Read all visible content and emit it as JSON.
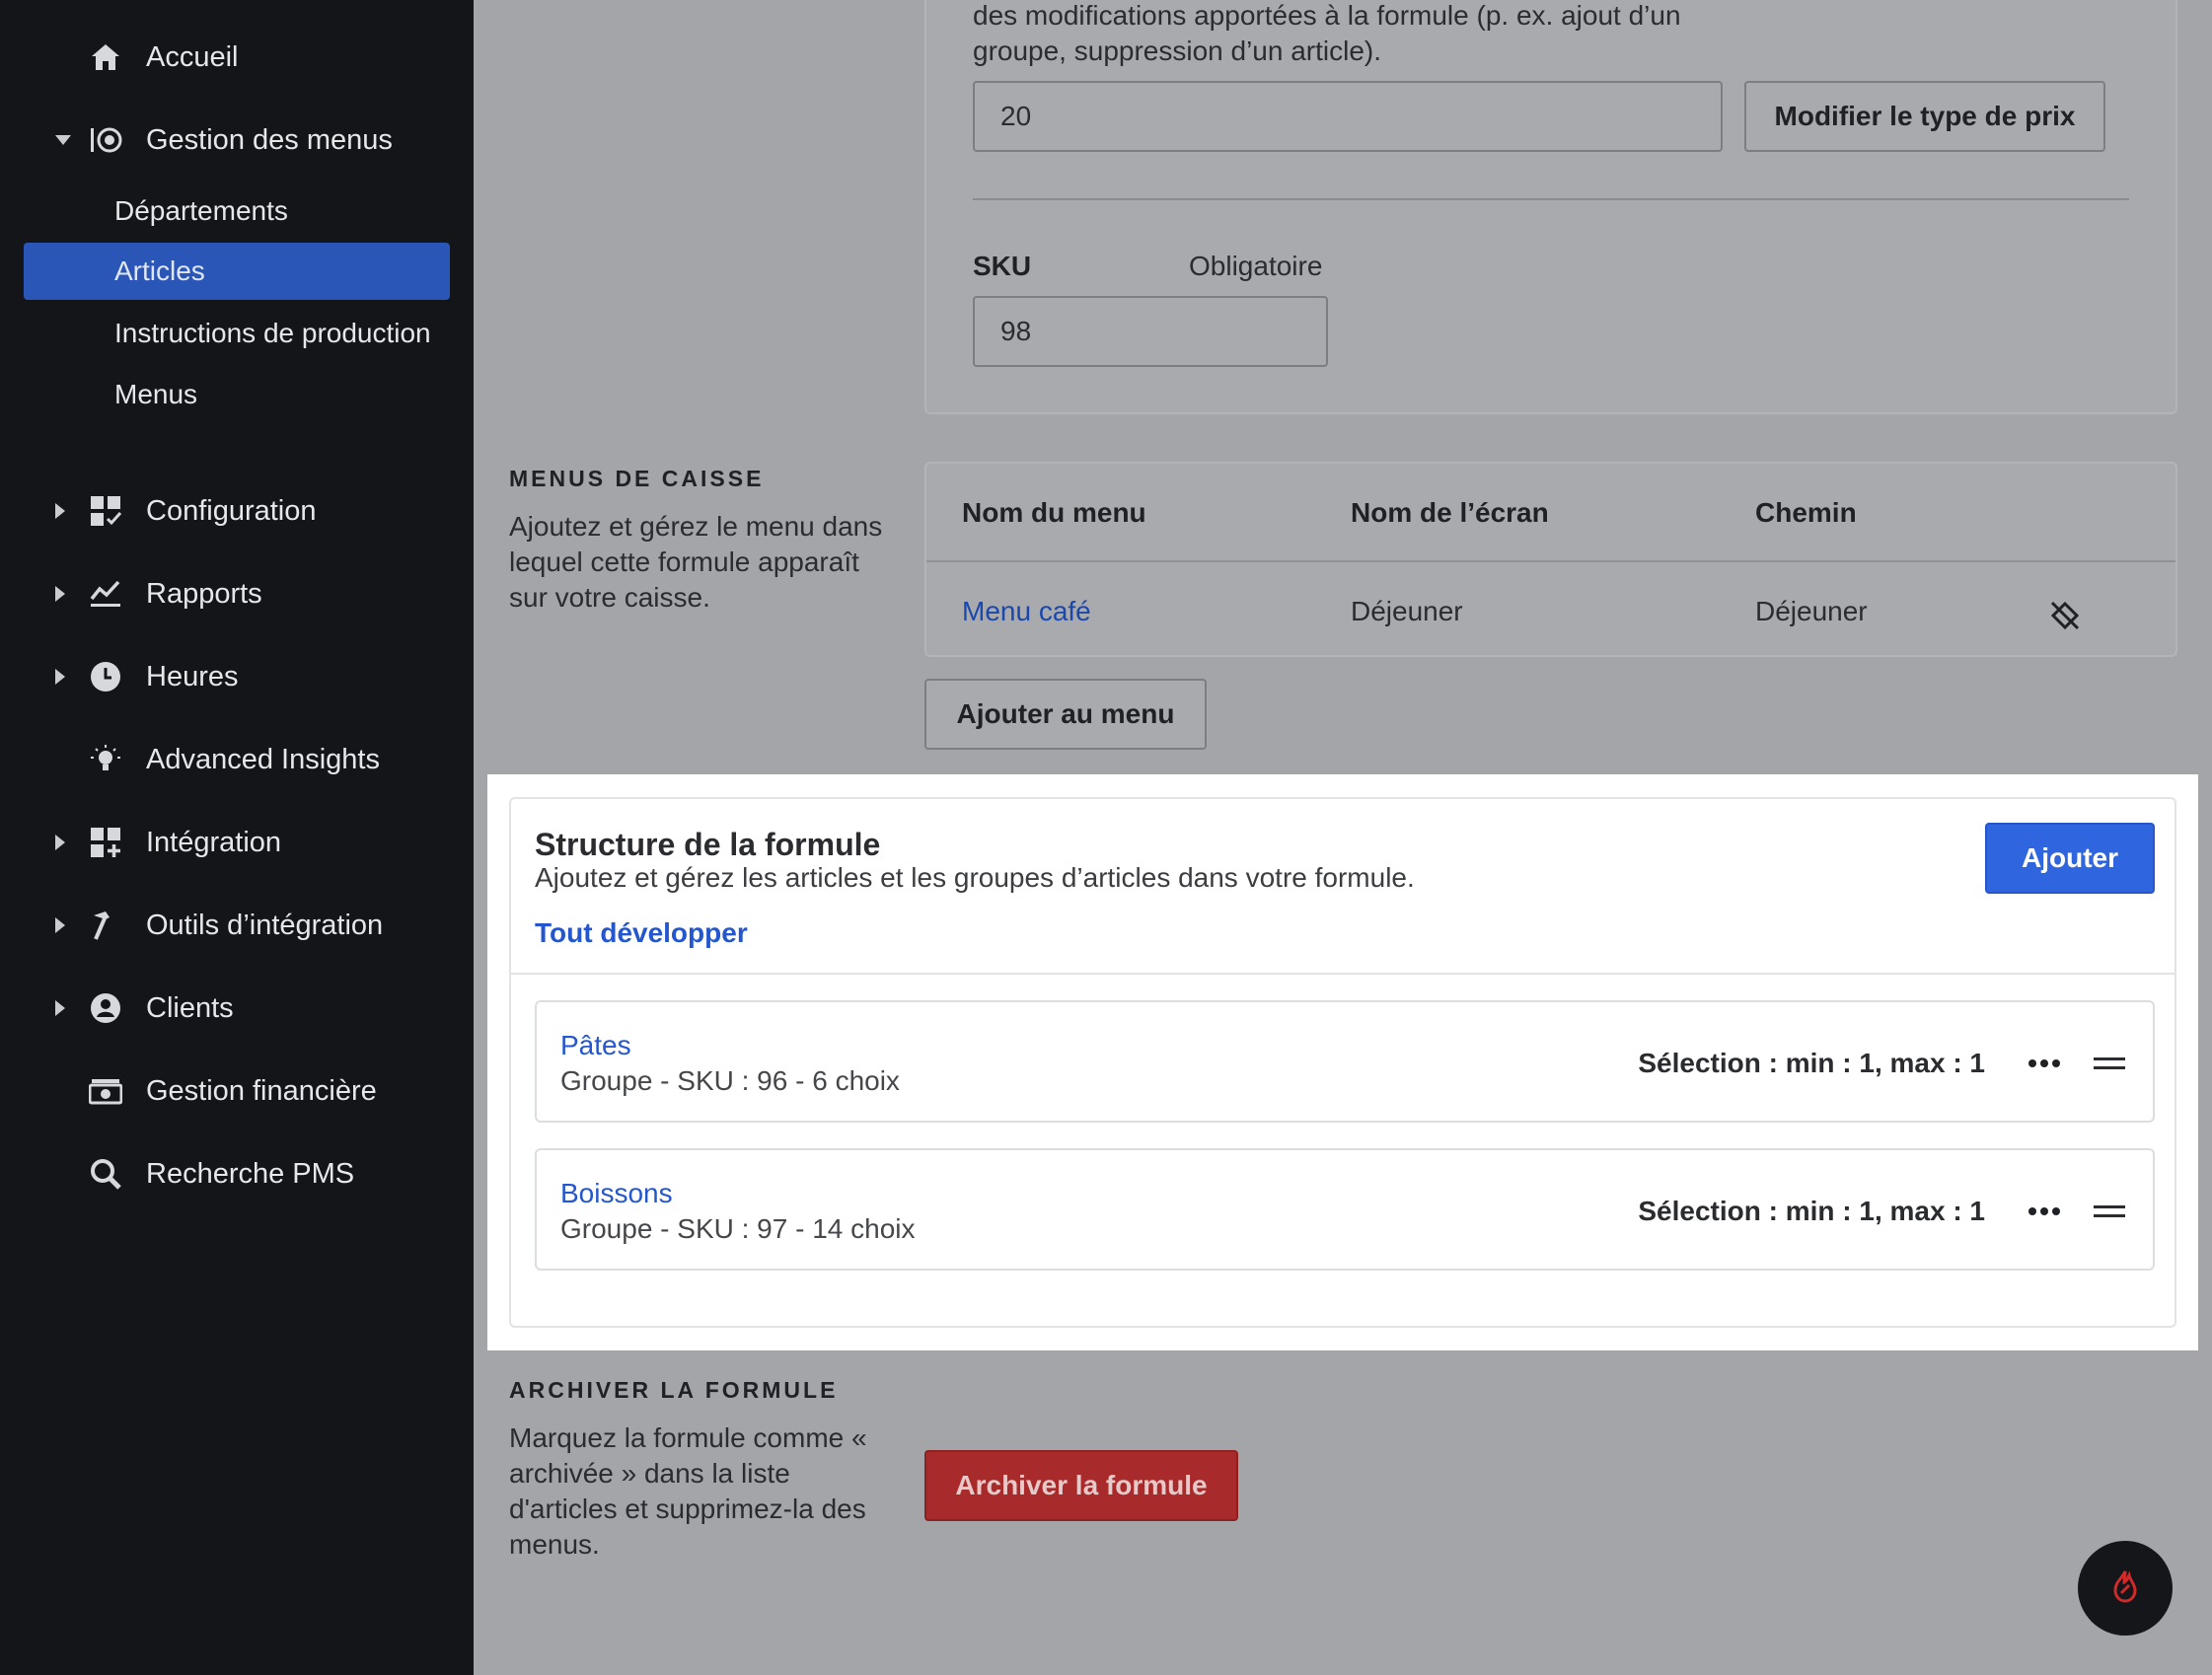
{
  "sidebar": {
    "items": [
      {
        "label": "Accueil",
        "icon": "home-icon"
      },
      {
        "label": "Gestion des menus",
        "icon": "menu-management-icon",
        "expanded": true
      },
      {
        "label": "Configuration",
        "icon": "configuration-icon"
      },
      {
        "label": "Rapports",
        "icon": "reports-icon"
      },
      {
        "label": "Heures",
        "icon": "clock-icon"
      },
      {
        "label": "Advanced Insights",
        "icon": "lightbulb-icon"
      },
      {
        "label": "Intégration",
        "icon": "integration-icon"
      },
      {
        "label": "Outils d’intégration",
        "icon": "hammer-icon"
      },
      {
        "label": "Clients",
        "icon": "user-circle-icon"
      },
      {
        "label": "Gestion financière",
        "icon": "money-icon"
      },
      {
        "label": "Recherche PMS",
        "icon": "search-icon"
      }
    ],
    "sub_items": [
      {
        "label": "Départements",
        "active": false
      },
      {
        "label": "Articles",
        "active": true
      },
      {
        "label": "Instructions de production",
        "active": false
      },
      {
        "label": "Menus",
        "active": false
      }
    ]
  },
  "pricing": {
    "description": "des modifications apportées à la formule (p. ex. ajout d’un groupe, suppression d’un article).",
    "price_value": "20",
    "change_price_type_label": "Modifier le type de prix"
  },
  "sku": {
    "label": "SKU",
    "required_label": "Obligatoire",
    "value": "98"
  },
  "pos_menus": {
    "title": "MENUS DE CAISSE",
    "description": "Ajoutez et gérez le menu dans lequel cette formule apparaît sur votre caisse.",
    "columns": [
      "Nom du menu",
      "Nom de l’écran",
      "Chemin"
    ],
    "rows": [
      {
        "menu_name": "Menu café",
        "screen_name": "Déjeuner",
        "path": "Déjeuner"
      }
    ],
    "add_button_label": "Ajouter au menu"
  },
  "structure": {
    "title": "Structure de la formule",
    "subtitle": "Ajoutez et gérez les articles et les groupes d’articles dans votre formule.",
    "expand_all_label": "Tout développer",
    "add_button_label": "Ajouter",
    "groups": [
      {
        "name": "Pâtes",
        "meta": "Groupe - SKU : 96 - 6 choix",
        "selection": "Sélection : min : 1, max : 1"
      },
      {
        "name": "Boissons",
        "meta": "Groupe - SKU : 97 - 14 choix",
        "selection": "Sélection : min : 1, max : 1"
      }
    ]
  },
  "archive": {
    "title": "ARCHIVER LA FORMULE",
    "description": "Marquez la formule comme « archivée » dans la liste d'articles et supprimez-la des menus.",
    "button_label": "Archiver la formule"
  },
  "colors": {
    "sidebar_bg": "#131519",
    "active_item": "#2a56b8",
    "primary_blue": "#2f66e0",
    "danger_red": "#a92a2a",
    "link_blue": "#2457cf"
  }
}
